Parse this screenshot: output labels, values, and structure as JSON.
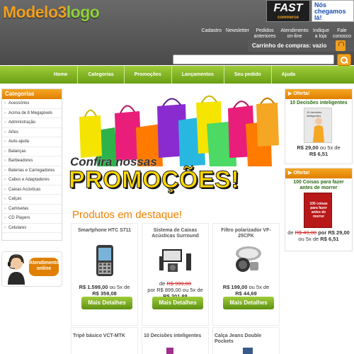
{
  "header": {
    "logo_part1": "Modelo3",
    "logo_part2": "logo",
    "fast_title": "FAST",
    "fast_sub": "commerce",
    "news_text": "Nós chegamos lá!",
    "links": [
      "Cadastro",
      "Newsletter",
      "Pedidos anteriores",
      "Atendimento on-line",
      "Indique a loja",
      "Fale conosco"
    ],
    "cart_label": "Carrinho de compras: vazio",
    "search_value": ""
  },
  "nav": {
    "items": [
      "Home",
      "Categorias",
      "Promoções",
      "Lançamentos",
      "Seu pedido",
      "Ajuda"
    ]
  },
  "categories": {
    "title": "Categorias",
    "items": [
      "Acessórios",
      "Acima de 8 Megapixels",
      "Administração",
      "Artes",
      "Auto-ajuda",
      "Balanças",
      "Barbeadores",
      "Baterias e Carregadores",
      "Cabos e Adaptadores",
      "Caixas Acústicas",
      "Calças",
      "Camisetas",
      "CD Players",
      "Celulares"
    ]
  },
  "attend": {
    "line1": "Atendimento",
    "line2": "online"
  },
  "promo": {
    "line1": "Confira nossas",
    "line2": "PROMOÇÕES!"
  },
  "featured_title": "Produtos em destaque!",
  "products": [
    {
      "name": "Smartphone HTC S711",
      "old": "",
      "price_main": "R$ 1.599,00",
      "price_conj": "ou 5x de",
      "price_inst": "R$ 359,08",
      "button": "Mais Detalhes"
    },
    {
      "name": "Sistema de Caixas Acústicas Surround",
      "old_prefix": "de",
      "old": "R$ 999,00",
      "price_main": "por R$ 899,00",
      "price_conj": "ou 5x de",
      "price_inst": "R$ 201,88",
      "button": "Mais Detalhes"
    },
    {
      "name": "Filtro polarizador VF-25CPK",
      "old": "",
      "price_main": "R$ 199,00",
      "price_conj": "ou 5x de",
      "price_inst": "R$ 44,69",
      "button": "Mais Detalhes"
    }
  ],
  "products_row2": [
    "Tripé básico VCT-MTK",
    "10 Decisões inteligentes",
    "Calça Jeans Double Pockets"
  ],
  "offers": [
    {
      "header": "Oferta!",
      "name": "10 Decisões inteligentes",
      "old_prefix": "",
      "old": "",
      "price_main": "R$ 29,00",
      "price_conj": "ou 5x de",
      "price_inst": "R$ 6,51",
      "book_title": "10 decisões inteligentes"
    },
    {
      "header": "Oferta!",
      "name": "100 Coisas para fazer antes de morrer",
      "old_prefix": "de",
      "old": "R$ 49,00",
      "price_main": "por R$ 29,00",
      "price_conj": "ou 5x de",
      "price_inst": "R$ 6,51",
      "book_title": "100 coisas para fazer antes de morrer"
    }
  ],
  "colors": {
    "accent_orange": "#f08000",
    "nav_green": "#7fb524",
    "header_gray": "#555555"
  }
}
